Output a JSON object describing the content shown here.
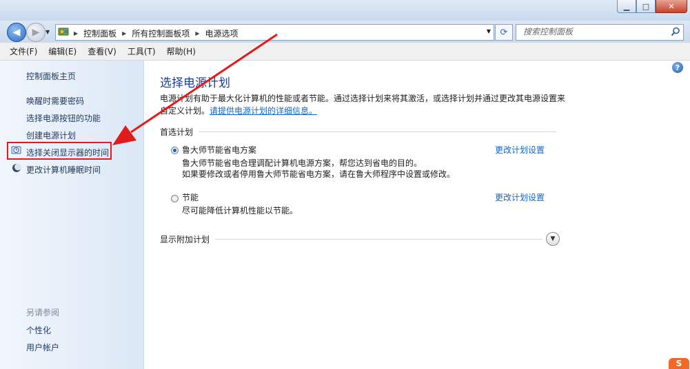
{
  "window": {
    "minimize": "▁",
    "maximize": "□",
    "close": "✕"
  },
  "nav": {
    "back": "◀",
    "forward": "▶",
    "breadcrumbs": [
      "控制面板",
      "所有控制面板项",
      "电源选项"
    ],
    "refresh": "⟳",
    "search_placeholder": "搜索控制面板"
  },
  "menu": [
    "文件(F)",
    "编辑(E)",
    "查看(V)",
    "工具(T)",
    "帮助(H)"
  ],
  "sidebar": {
    "home": "控制面板主页",
    "links": [
      "唤醒时需要密码",
      "选择电源按钮的功能",
      "创建电源计划",
      "选择关闭显示器的时间",
      "更改计算机睡眠时间"
    ],
    "see_also": "另请参阅",
    "see_also_links": [
      "个性化",
      "用户帐户"
    ]
  },
  "main": {
    "title": "选择电源计划",
    "desc": "电源计划有助于最大化计算机的性能或者节能。通过选择计划来将其激活，或选择计划并通过更改其电源设置来自定义计划。",
    "desc_link": "请提供电源计划的详细信息。",
    "preferred_label": "首选计划",
    "plans": [
      {
        "name": "鲁大师节能省电方案",
        "selected": true,
        "desc1": "鲁大师节能省电合理调配计算机电源方案，帮您达到省电的目的。",
        "desc2": "如果要修改或者停用鲁大师节能省电方案，请在鲁大师程序中设置或修改。",
        "link": "更改计划设置"
      },
      {
        "name": "节能",
        "selected": false,
        "desc1": "尽可能降低计算机性能以节能。",
        "link": "更改计划设置"
      }
    ],
    "more_plans": "显示附加计划"
  },
  "colors": {
    "annotation": "#e41a1a",
    "link": "#1764c8",
    "title": "#1e3d8f"
  },
  "corner_logo": "S"
}
